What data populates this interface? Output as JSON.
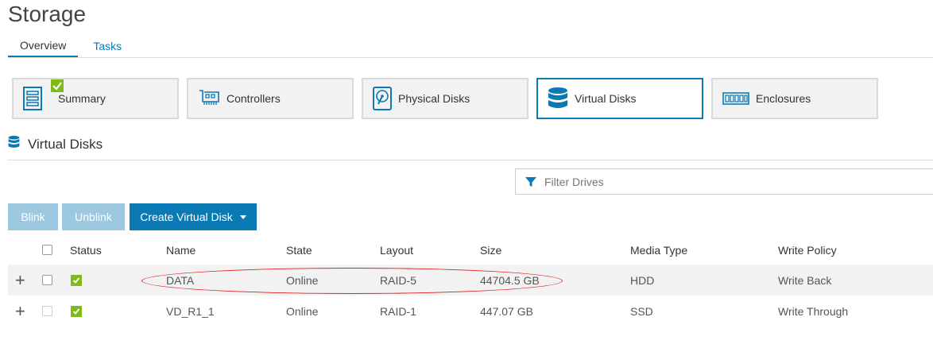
{
  "page": {
    "title": "Storage"
  },
  "tabs": [
    {
      "label": "Overview",
      "active": true
    },
    {
      "label": "Tasks",
      "active": false
    }
  ],
  "tiles": [
    {
      "label": "Summary",
      "icon": "summary-icon",
      "badge": "check"
    },
    {
      "label": "Controllers",
      "icon": "controller-card-icon"
    },
    {
      "label": "Physical Disks",
      "icon": "hard-disk-icon"
    },
    {
      "label": "Virtual Disks",
      "icon": "database-icon",
      "selected": true
    },
    {
      "label": "Enclosures",
      "icon": "enclosure-icon"
    }
  ],
  "section": {
    "title": "Virtual Disks",
    "icon": "database-icon"
  },
  "filter": {
    "placeholder": "Filter Drives",
    "icon": "funnel-icon"
  },
  "toolbar": {
    "blink_label": "Blink",
    "unblink_label": "Unblink",
    "create_label": "Create Virtual Disk"
  },
  "table": {
    "columns": [
      "Status",
      "Name",
      "State",
      "Layout",
      "Size",
      "Media Type",
      "Write Policy"
    ],
    "rows": [
      {
        "status": "ok",
        "name": "DATA",
        "state": "Online",
        "layout": "RAID-5",
        "size": "44704.5 GB",
        "media_type": "HDD",
        "write_policy": "Write Back"
      },
      {
        "status": "ok",
        "name": "VD_R1_1",
        "state": "Online",
        "layout": "RAID-1",
        "size": "447.07 GB",
        "media_type": "SSD",
        "write_policy": "Write Through"
      }
    ]
  },
  "colors": {
    "accent": "#0a79b4",
    "accent_disabled": "#9cc8e0",
    "status_ok": "#7dba1a",
    "highlight": "#dd2222"
  }
}
